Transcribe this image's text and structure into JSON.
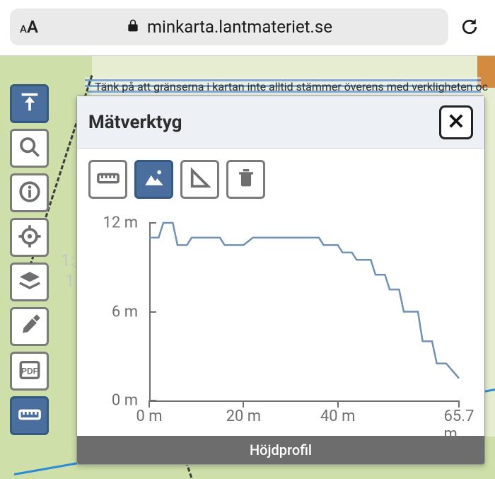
{
  "browser": {
    "domain": "minkarta.lantmateriet.se"
  },
  "map": {
    "notice": "Tänk på att gränserna i kartan inte alltid stämmer överens med verkligheten och"
  },
  "toolbar": {
    "items": [
      {
        "name": "panel-toggle",
        "active": true
      },
      {
        "name": "search",
        "active": false
      },
      {
        "name": "info",
        "active": false
      },
      {
        "name": "locate",
        "active": false
      },
      {
        "name": "layers",
        "active": false
      },
      {
        "name": "draw",
        "active": false
      },
      {
        "name": "pdf",
        "active": false
      },
      {
        "name": "measure",
        "active": true
      }
    ]
  },
  "panel": {
    "title": "Mätverktyg",
    "footer_label": "Höjdprofil",
    "tools": [
      {
        "name": "measure-distance",
        "active": false
      },
      {
        "name": "elevation-profile",
        "active": true
      },
      {
        "name": "measure-area",
        "active": false
      },
      {
        "name": "clear",
        "active": false
      }
    ]
  },
  "chart_data": {
    "type": "line",
    "xlabel": "",
    "ylabel": "",
    "x_unit": "m",
    "y_unit": "m",
    "xlim": [
      0,
      65.7
    ],
    "ylim": [
      0,
      12
    ],
    "x_ticks": [
      0,
      20,
      40,
      65.7
    ],
    "x_tick_labels": [
      "0 m",
      "20 m",
      "40 m",
      "65.7 m"
    ],
    "y_ticks": [
      0,
      6,
      12
    ],
    "y_tick_labels": [
      "0 m",
      "6 m",
      "12 m"
    ],
    "series": [
      {
        "name": "Höjdprofil",
        "x": [
          0,
          2,
          3,
          5,
          6,
          8,
          9,
          15,
          16,
          20,
          22,
          36,
          37,
          40,
          41,
          43,
          44,
          47,
          48,
          50,
          51,
          53,
          54,
          57,
          58,
          60,
          61,
          63,
          65.7
        ],
        "y": [
          11,
          11,
          12,
          12,
          10.5,
          10.5,
          11,
          11,
          10.5,
          10.5,
          11,
          11,
          10.5,
          10.5,
          10,
          10,
          9.5,
          9.5,
          8.5,
          8.5,
          7.5,
          7.5,
          6,
          6,
          4,
          4,
          2.5,
          2.5,
          1.5
        ]
      }
    ]
  }
}
